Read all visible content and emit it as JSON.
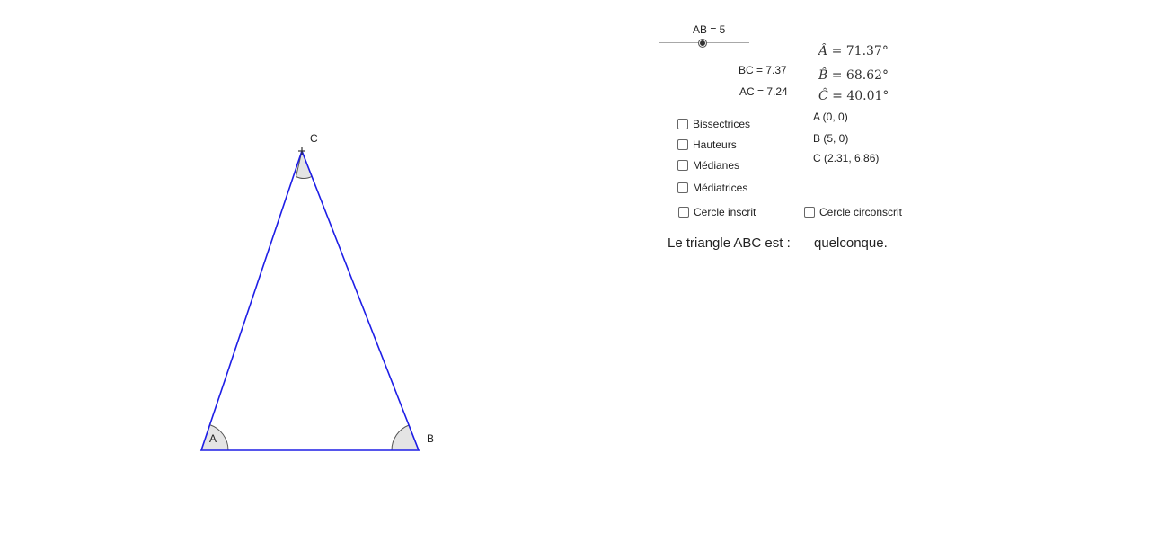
{
  "slider": {
    "label": "AB = 5",
    "value": 5
  },
  "lengths": {
    "bc": "BC = 7.37",
    "ac": "AC = 7.24"
  },
  "angles": {
    "a": {
      "symbol": "Â",
      "value": "= 71.37°"
    },
    "b": {
      "symbol": "B̂",
      "value": "= 68.62°"
    },
    "c": {
      "symbol": "Ĉ",
      "value": "= 40.01°"
    }
  },
  "coords": {
    "a": "A (0, 0)",
    "b": "B (5, 0)",
    "c": "C (2.31, 6.86)"
  },
  "checkboxes": {
    "bissectrices": "Bissectrices",
    "hauteurs": "Hauteurs",
    "medianes": "Médianes",
    "mediatrices": "Médiatrices",
    "cercle_inscrit": "Cercle inscrit",
    "cercle_circonscrit": "Cercle circonscrit"
  },
  "result": {
    "prefix": "Le triangle ABC est :",
    "type": "quelconque."
  },
  "points": {
    "a": "A",
    "b": "B",
    "c": "C"
  },
  "colors": {
    "triangle": "#1e1ee6",
    "angle_fill": "#e4e4e4"
  }
}
